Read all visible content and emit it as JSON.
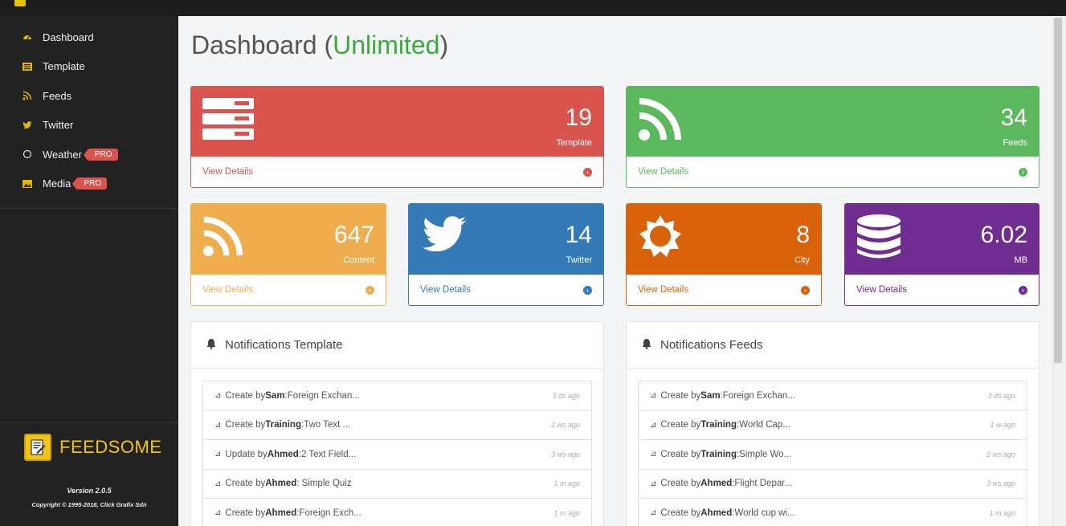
{
  "sidebar": {
    "items": [
      {
        "label": "Dashboard",
        "icon": "dashboard-icon"
      },
      {
        "label": "Template",
        "icon": "template-icon"
      },
      {
        "label": "Feeds",
        "icon": "rss-icon"
      },
      {
        "label": "Twitter",
        "icon": "twitter-icon"
      },
      {
        "label": "Weather",
        "icon": "weather-icon",
        "badge": "PRO"
      },
      {
        "label": "Media",
        "icon": "image-icon",
        "badge": "PRO"
      }
    ],
    "brand": "FEEDSOME",
    "version": "Version 2.0.5",
    "copyright": "Copyright © 1995-2018, Click Grafix Sdn"
  },
  "page": {
    "title": "Dashboard (",
    "title_accent": "Unlimited",
    "title_close": ")"
  },
  "stats": [
    {
      "value": "19",
      "label": "Template",
      "link": "View Details",
      "color": "#d9534f",
      "icon": "server-icon"
    },
    {
      "value": "34",
      "label": "Feeds",
      "link": "View Details",
      "color": "#5cb85c",
      "icon": "rss-icon"
    },
    {
      "value": "647",
      "label": "Content",
      "link": "View Details",
      "color": "#f0ad4e",
      "icon": "rss-icon"
    },
    {
      "value": "14",
      "label": "Twitter",
      "link": "View Details",
      "color": "#337ab7",
      "icon": "twitter-icon"
    },
    {
      "value": "8",
      "label": "City",
      "link": "View Details",
      "color": "#d9620a",
      "icon": "sun-icon"
    },
    {
      "value": "6.02",
      "label": "MB",
      "link": "View Details",
      "color": "#6f2c91",
      "icon": "database-icon"
    }
  ],
  "notifications_template": {
    "title": "Notifications Template",
    "rows": [
      {
        "action": "Create by ",
        "user": "Sam",
        "text": ":Foreign Exchan...",
        "time": "3 ds ago"
      },
      {
        "action": "Create by ",
        "user": "Training",
        "text": ":Two Text ...",
        "time": "2 ws ago"
      },
      {
        "action": "Update by ",
        "user": "Ahmed",
        "text": ":2 Text Field...",
        "time": "3 ws ago"
      },
      {
        "action": "Create by ",
        "user": "Ahmed",
        "text": ": Simple Quiz",
        "time": "1 m ago"
      },
      {
        "action": "Create by ",
        "user": "Ahmed",
        "text": ":Foreign Exch...",
        "time": "1 m ago"
      }
    ]
  },
  "notifications_feeds": {
    "title": "Notifications Feeds",
    "rows": [
      {
        "action": "Create by ",
        "user": "Sam",
        "text": ":Foreign Exchan...",
        "time": "3 ds ago"
      },
      {
        "action": "Create by ",
        "user": "Training",
        "text": ":World Cap...",
        "time": "1 w ago"
      },
      {
        "action": "Create by ",
        "user": "Training",
        "text": ":Simple Wo...",
        "time": "2 ws ago"
      },
      {
        "action": "Create by ",
        "user": "Ahmed",
        "text": ":Flight Depar...",
        "time": "3 ws ago"
      },
      {
        "action": "Create by ",
        "user": "Ahmed",
        "text": ":World cup wi...",
        "time": "1 m ago"
      }
    ]
  }
}
